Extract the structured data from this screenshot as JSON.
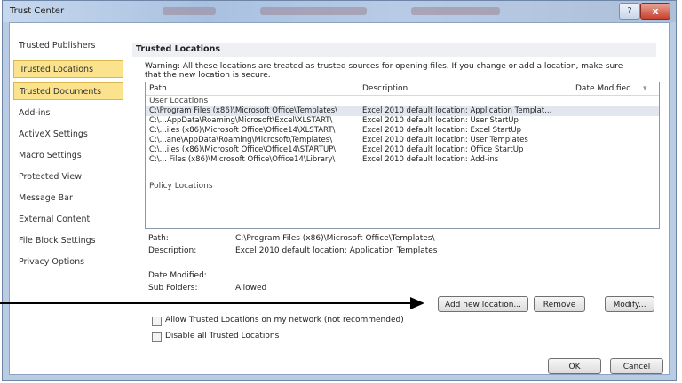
{
  "window": {
    "title": "Trust Center",
    "help_symbol": "?",
    "close_symbol": "x"
  },
  "nav": {
    "items": [
      {
        "label": "Trusted Publishers"
      },
      {
        "label": "Trusted Locations"
      },
      {
        "label": "Trusted Documents"
      },
      {
        "label": "Add-ins"
      },
      {
        "label": "ActiveX Settings"
      },
      {
        "label": "Macro Settings"
      },
      {
        "label": "Protected View"
      },
      {
        "label": "Message Bar"
      },
      {
        "label": "External Content"
      },
      {
        "label": "File Block Settings"
      },
      {
        "label": "Privacy Options"
      }
    ]
  },
  "main": {
    "section_title": "Trusted Locations",
    "warning_line1": "Warning: All these locations are treated as trusted sources for opening files.  If you change or add a location, make sure",
    "warning_line2": "that the new location is secure.",
    "columns": {
      "path": "Path",
      "description": "Description",
      "date_modified": "Date Modified"
    },
    "user_group": "User Locations",
    "rows": [
      {
        "path": "C:\\Program Files (x86)\\Microsoft Office\\Templates\\",
        "description": "Excel 2010 default location: Application Templat...",
        "selected": true
      },
      {
        "path": "C:\\...AppData\\Roaming\\Microsoft\\Excel\\XLSTART\\",
        "description": "Excel 2010 default location: User StartUp"
      },
      {
        "path": "C:\\...iles (x86)\\Microsoft Office\\Office14\\XLSTART\\",
        "description": "Excel 2010 default location: Excel StartUp"
      },
      {
        "path": "C:\\...ane\\AppData\\Roaming\\Microsoft\\Templates\\",
        "description": "Excel 2010 default location: User Templates"
      },
      {
        "path": "C:\\...iles (x86)\\Microsoft Office\\Office14\\STARTUP\\",
        "description": "Excel 2010 default location: Office StartUp"
      },
      {
        "path": "C:\\... Files (x86)\\Microsoft Office\\Office14\\Library\\",
        "description": "Excel 2010 default location: Add-ins"
      }
    ],
    "policy_group": "Policy Locations",
    "details": {
      "path_label": "Path:",
      "path_value": "C:\\Program Files (x86)\\Microsoft Office\\Templates\\",
      "description_label": "Description:",
      "description_value": "Excel 2010 default location: Application Templates",
      "date_label": "Date Modified:",
      "date_value": "",
      "subfolders_label": "Sub Folders:",
      "subfolders_value": "Allowed"
    },
    "buttons": {
      "add": "Add new location...",
      "remove": "Remove",
      "modify": "Modify..."
    },
    "checkboxes": {
      "network": "Allow Trusted Locations on my network (not recommended)",
      "disable": "Disable all Trusted Locations"
    }
  },
  "footer": {
    "ok": "OK",
    "cancel": "Cancel"
  }
}
